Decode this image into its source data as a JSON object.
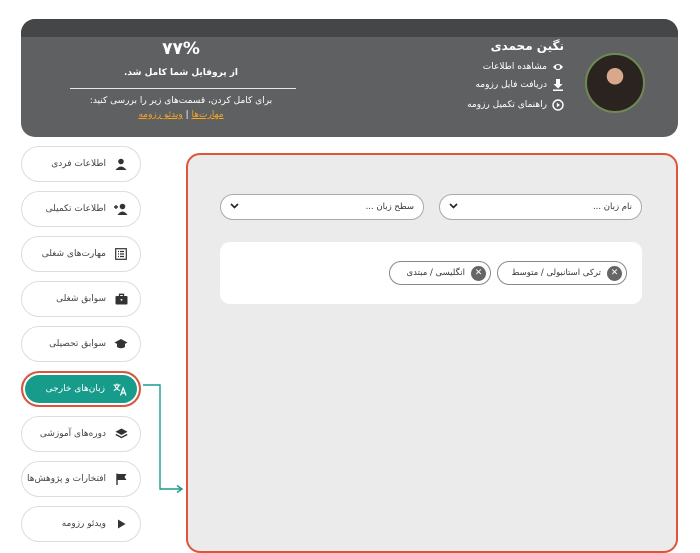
{
  "profile": {
    "name": "نگین محمدی",
    "links": [
      {
        "label": "مشاهده اطلاعات",
        "icon": "eye-icon"
      },
      {
        "label": "دریافت فایل رزومه",
        "icon": "download-icon"
      },
      {
        "label": "راهنمای تکمیل رزومه",
        "icon": "play-circle-icon"
      }
    ]
  },
  "completion": {
    "percent": "۷۷%",
    "text": "از پروفایل شما کامل شد.",
    "review_text": "برای کامل کردن، قسمت‌های زیر را بررسی کنید:",
    "links": [
      "مهارت‌ها",
      "ویدئو رزومه"
    ],
    "separator": "|"
  },
  "sidebar": {
    "items": [
      {
        "label": "اطلاعات فردی",
        "icon": "user-icon"
      },
      {
        "label": "اطلاعات تکمیلی",
        "icon": "user-plus-icon"
      },
      {
        "label": "مهارت‌های شغلی",
        "icon": "list-icon"
      },
      {
        "label": "سوابق شغلی",
        "icon": "briefcase-icon"
      },
      {
        "label": "سوابق تحصیلی",
        "icon": "graduation-cap-icon"
      },
      {
        "label": "زبان‌های خارجی",
        "icon": "translate-icon",
        "active": true
      },
      {
        "label": "دوره‌های آموزشی",
        "icon": "layers-icon"
      },
      {
        "label": "افتخارات و پژوهش‌ها",
        "icon": "flag-icon"
      },
      {
        "label": "ویدئو رزومه",
        "icon": "play-icon"
      }
    ]
  },
  "languages": {
    "language_select": {
      "placeholder": "نام زبان ..."
    },
    "level_select": {
      "placeholder": "سطح زبان ..."
    },
    "chips": [
      "ترکی استانبولی / متوسط",
      "انگلیسی / مبتدی"
    ]
  },
  "colors": {
    "accent": "#179c8c",
    "highlight": "#e0533b",
    "link": "#f5a623",
    "header": "#5e6062"
  }
}
